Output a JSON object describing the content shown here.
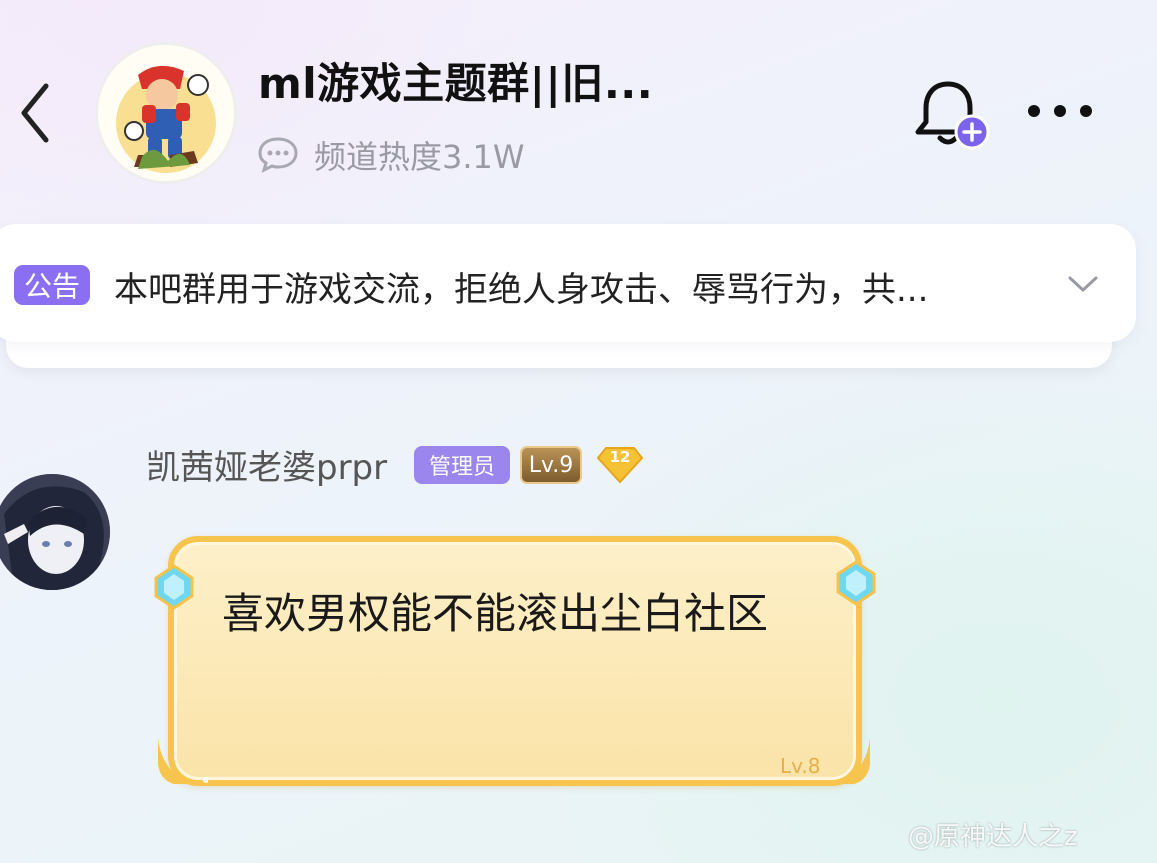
{
  "header": {
    "title": "ml游戏主题群||旧...",
    "heat_label": "频道热度3.1W"
  },
  "notice": {
    "badge": "公告",
    "text": "本吧群用于游戏交流，拒绝人身攻击、辱骂行为，共..."
  },
  "message": {
    "username": "凯茜娅老婆prpr",
    "role_badge": "管理员",
    "level_badge": "Lv.9",
    "rank_badge": "12",
    "text": "喜欢男权能不能滚出尘白社区",
    "bubble_level": "Lv.8"
  },
  "watermark": "@原神达人之z",
  "colors": {
    "accent_purple": "#8a6ff2",
    "bubble_border": "#f7c54d",
    "bubble_fill": "#fae3a8"
  }
}
